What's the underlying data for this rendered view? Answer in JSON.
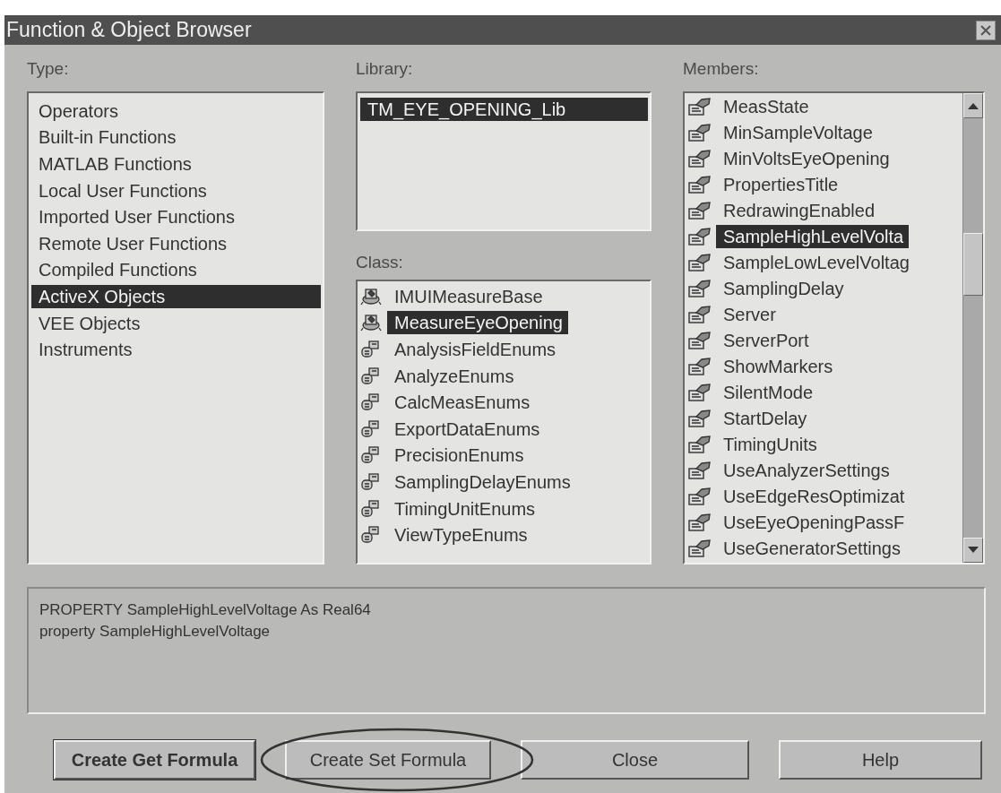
{
  "window": {
    "title": "Function & Object Browser"
  },
  "type_panel": {
    "label": "Type:",
    "items": [
      {
        "label": "Operators",
        "selected": false
      },
      {
        "label": "Built-in Functions",
        "selected": false
      },
      {
        "label": "MATLAB Functions",
        "selected": false
      },
      {
        "label": "Local User Functions",
        "selected": false
      },
      {
        "label": "Imported User Functions",
        "selected": false
      },
      {
        "label": "Remote User Functions",
        "selected": false
      },
      {
        "label": "Compiled Functions",
        "selected": false
      },
      {
        "label": "ActiveX Objects",
        "selected": true
      },
      {
        "label": "VEE Objects",
        "selected": false
      },
      {
        "label": "Instruments",
        "selected": false
      }
    ]
  },
  "library_panel": {
    "label": "Library:",
    "items": [
      {
        "label": "TM_EYE_OPENING_Lib",
        "selected": true
      }
    ]
  },
  "class_panel": {
    "label": "Class:",
    "items": [
      {
        "label": "IMUIMeasureBase",
        "kind": "class",
        "selected": false
      },
      {
        "label": "MeasureEyeOpening",
        "kind": "class",
        "selected": true
      },
      {
        "label": "AnalysisFieldEnums",
        "kind": "enum",
        "selected": false
      },
      {
        "label": "AnalyzeEnums",
        "kind": "enum",
        "selected": false
      },
      {
        "label": "CalcMeasEnums",
        "kind": "enum",
        "selected": false
      },
      {
        "label": "ExportDataEnums",
        "kind": "enum",
        "selected": false
      },
      {
        "label": "PrecisionEnums",
        "kind": "enum",
        "selected": false
      },
      {
        "label": "SamplingDelayEnums",
        "kind": "enum",
        "selected": false
      },
      {
        "label": "TimingUnitEnums",
        "kind": "enum",
        "selected": false
      },
      {
        "label": "ViewTypeEnums",
        "kind": "enum",
        "selected": false
      }
    ]
  },
  "members_panel": {
    "label": "Members:",
    "items": [
      {
        "label": "MeasState",
        "selected": false
      },
      {
        "label": "MinSampleVoltage",
        "selected": false
      },
      {
        "label": "MinVoltsEyeOpening",
        "selected": false
      },
      {
        "label": "PropertiesTitle",
        "selected": false
      },
      {
        "label": "RedrawingEnabled",
        "selected": false
      },
      {
        "label": "SampleHighLevelVolta",
        "selected": true
      },
      {
        "label": "SampleLowLevelVoltag",
        "selected": false
      },
      {
        "label": "SamplingDelay",
        "selected": false
      },
      {
        "label": "Server",
        "selected": false
      },
      {
        "label": "ServerPort",
        "selected": false
      },
      {
        "label": "ShowMarkers",
        "selected": false
      },
      {
        "label": "SilentMode",
        "selected": false
      },
      {
        "label": "StartDelay",
        "selected": false
      },
      {
        "label": "TimingUnits",
        "selected": false
      },
      {
        "label": "UseAnalyzerSettings",
        "selected": false
      },
      {
        "label": "UseEdgeResOptimizat",
        "selected": false
      },
      {
        "label": "UseEyeOpeningPassF",
        "selected": false
      },
      {
        "label": "UseGeneratorSettings",
        "selected": false
      }
    ]
  },
  "description": {
    "lines": [
      "PROPERTY SampleHighLevelVoltage As Real64",
      "property SampleHighLevelVoltage"
    ]
  },
  "buttons": [
    {
      "label": "Create Get Formula",
      "default": true,
      "circled": false
    },
    {
      "label": "Create Set Formula",
      "default": false,
      "circled": true
    },
    {
      "label": "Close",
      "default": false,
      "circled": false
    },
    {
      "label": "Help",
      "default": false,
      "circled": false
    }
  ]
}
